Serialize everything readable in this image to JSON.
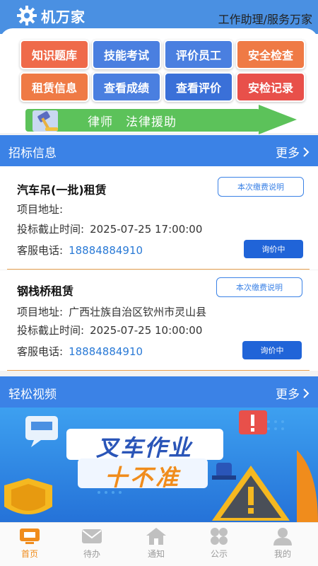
{
  "header": {
    "app_name": "机万家",
    "slogan": "工作助理/服务万家",
    "brand_color": "#4a90e2"
  },
  "quick_grid": [
    {
      "label": "知识题库",
      "color": "#ef6a4a"
    },
    {
      "label": "技能考试",
      "color": "#4a7fe0"
    },
    {
      "label": "评价员工",
      "color": "#4a7fe0"
    },
    {
      "label": "安全检查",
      "color": "#ef7a45"
    },
    {
      "label": "租赁信息",
      "color": "#ef7a45"
    },
    {
      "label": "查看成绩",
      "color": "#4a7fe0"
    },
    {
      "label": "查看评价",
      "color": "#3a70d8"
    },
    {
      "label": "安检记录",
      "color": "#e8504a"
    }
  ],
  "banner": {
    "text": "律师　法律援助",
    "icon": "gavel-icon"
  },
  "tender": {
    "section_title": "招标信息",
    "more_label": "更多",
    "items": [
      {
        "title": "汽车吊(一批)租赁",
        "address_label": "项目地址:",
        "address": "",
        "deadline_label": "投标截止时间:",
        "deadline": "2025-07-25 17:00:00",
        "phone_label": "客服电话:",
        "phone": "18884884910",
        "fee_button": "本次缴费说明",
        "status_button": "询价中"
      },
      {
        "title": "钢栈桥租赁",
        "address_label": "项目地址:",
        "address": "广西壮族自治区钦州市灵山县",
        "deadline_label": "投标截止时间:",
        "deadline": "2025-07-25 10:00:00",
        "phone_label": "客服电话:",
        "phone": "18884884910",
        "fee_button": "本次缴费说明",
        "status_button": "询价中"
      }
    ]
  },
  "video": {
    "section_title": "轻松视频",
    "more_label": "更多",
    "thumb_line1": "叉车作业",
    "thumb_line2": "十不准",
    "alert_mark": "!"
  },
  "tabbar": [
    {
      "label": "首页",
      "icon": "monitor-icon",
      "active": true
    },
    {
      "label": "待办",
      "icon": "mail-icon",
      "active": false
    },
    {
      "label": "通知",
      "icon": "house-icon",
      "active": false
    },
    {
      "label": "公示",
      "icon": "clover-icon",
      "active": false
    },
    {
      "label": "我的",
      "icon": "user-icon",
      "active": false
    }
  ],
  "colors": {
    "accent": "#3b82e6",
    "active_tab": "#f08c1c",
    "divider": "#e8a050",
    "phone": "#2a7ad6"
  }
}
